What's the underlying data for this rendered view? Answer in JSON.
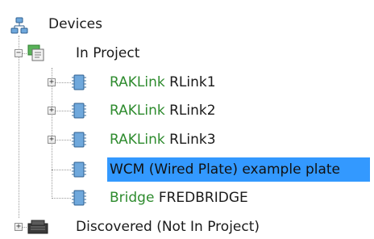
{
  "tree": {
    "root": {
      "label": "Devices",
      "icon": "network-devices-icon"
    },
    "in_project": {
      "label": "In Project",
      "icon": "project-node-icon",
      "expander": "−",
      "children": [
        {
          "brand": "RAKLink",
          "name": "RLink1",
          "icon": "device-chip-icon",
          "expander": "+"
        },
        {
          "brand": "RAKLink",
          "name": "RLink2",
          "icon": "device-chip-icon",
          "expander": "+"
        },
        {
          "brand": "RAKLink",
          "name": "RLink3",
          "icon": "device-chip-icon",
          "expander": "+"
        },
        {
          "brand": "WCM (Wired Plate) example plate",
          "name": "",
          "icon": "device-chip-icon",
          "selected": true
        },
        {
          "brand": "Bridge",
          "name": "FREDBRIDGE",
          "icon": "device-chip-icon"
        }
      ]
    },
    "discovered": {
      "label": "Discovered (Not In Project)",
      "icon": "discovered-devices-icon",
      "expander": "+"
    }
  },
  "colors": {
    "selection": "#3399ff",
    "brand_text": "#2e8b2e",
    "tree_lines": "#9a9a9a"
  }
}
